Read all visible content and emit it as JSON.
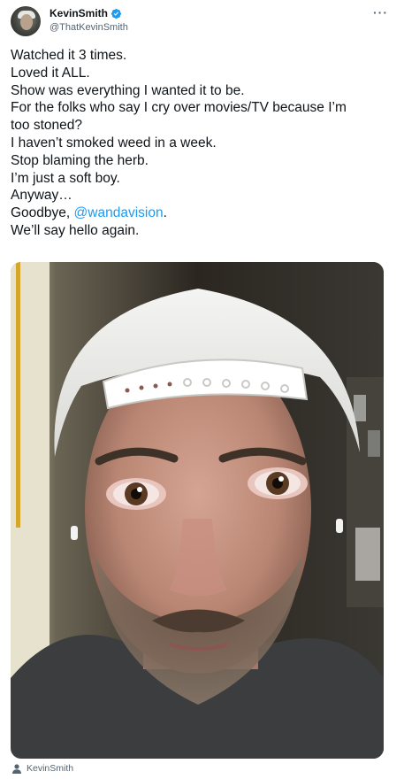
{
  "author": {
    "display_name": "KevinSmith",
    "handle": "@ThatKevinSmith",
    "verified_icon": "verified-badge-icon",
    "avatar_icon": "avatar"
  },
  "menu": {
    "more_label": "···"
  },
  "tweet": {
    "lines": [
      "Watched it 3 times.",
      "Loved it ALL.",
      "Show was everything I wanted it to be.",
      "For the folks who say I cry over movies/TV because I’m",
      "too stoned?",
      "I haven’t smoked weed in a week.",
      "Stop blaming the herb.",
      "I’m just a soft boy.",
      "Anyway…"
    ],
    "goodbye_prefix": "Goodbye, ",
    "mention": "@wandavision",
    "goodbye_suffix": ".",
    "last_line": "We’ll say hello again."
  },
  "media": {
    "alt": "Selfie of a man wearing a white backwards cap with teary red eyes"
  },
  "tagged": {
    "icon": "person-icon",
    "name": "KevinSmith"
  },
  "colors": {
    "link": "#1d9bf0",
    "secondary": "#536471",
    "text": "#0f1419"
  }
}
